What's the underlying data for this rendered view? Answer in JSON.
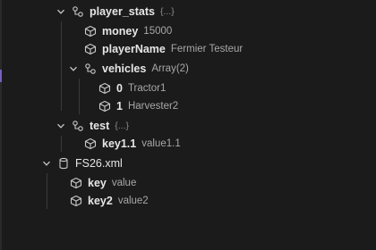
{
  "tree": {
    "player_stats": {
      "key": "player_stats",
      "meta": "{...}"
    },
    "money": {
      "key": "money",
      "value": "15000"
    },
    "playerName": {
      "key": "playerName",
      "value": "Fermier Testeur"
    },
    "vehicles": {
      "key": "vehicles",
      "meta": "Array(2)"
    },
    "vehicle0": {
      "key": "0",
      "value": "Tractor1"
    },
    "vehicle1": {
      "key": "1",
      "value": "Harvester2"
    },
    "test": {
      "key": "test",
      "meta": "{...}"
    },
    "key1_1": {
      "key": "key1.1",
      "value": "value1.1"
    },
    "file": {
      "name": "FS26.xml"
    },
    "key": {
      "key": "key",
      "value": "value"
    },
    "key2": {
      "key": "key2",
      "value": "value2"
    }
  },
  "icons": {
    "object": "object-icon",
    "property": "cube-icon",
    "file": "database-icon",
    "expanded": "chevron-down-icon"
  },
  "colors": {
    "background": "#1b1b1b",
    "key_text": "#e6e6e6",
    "value_text": "#a7a7a7",
    "accent": "#7b5cc8"
  }
}
